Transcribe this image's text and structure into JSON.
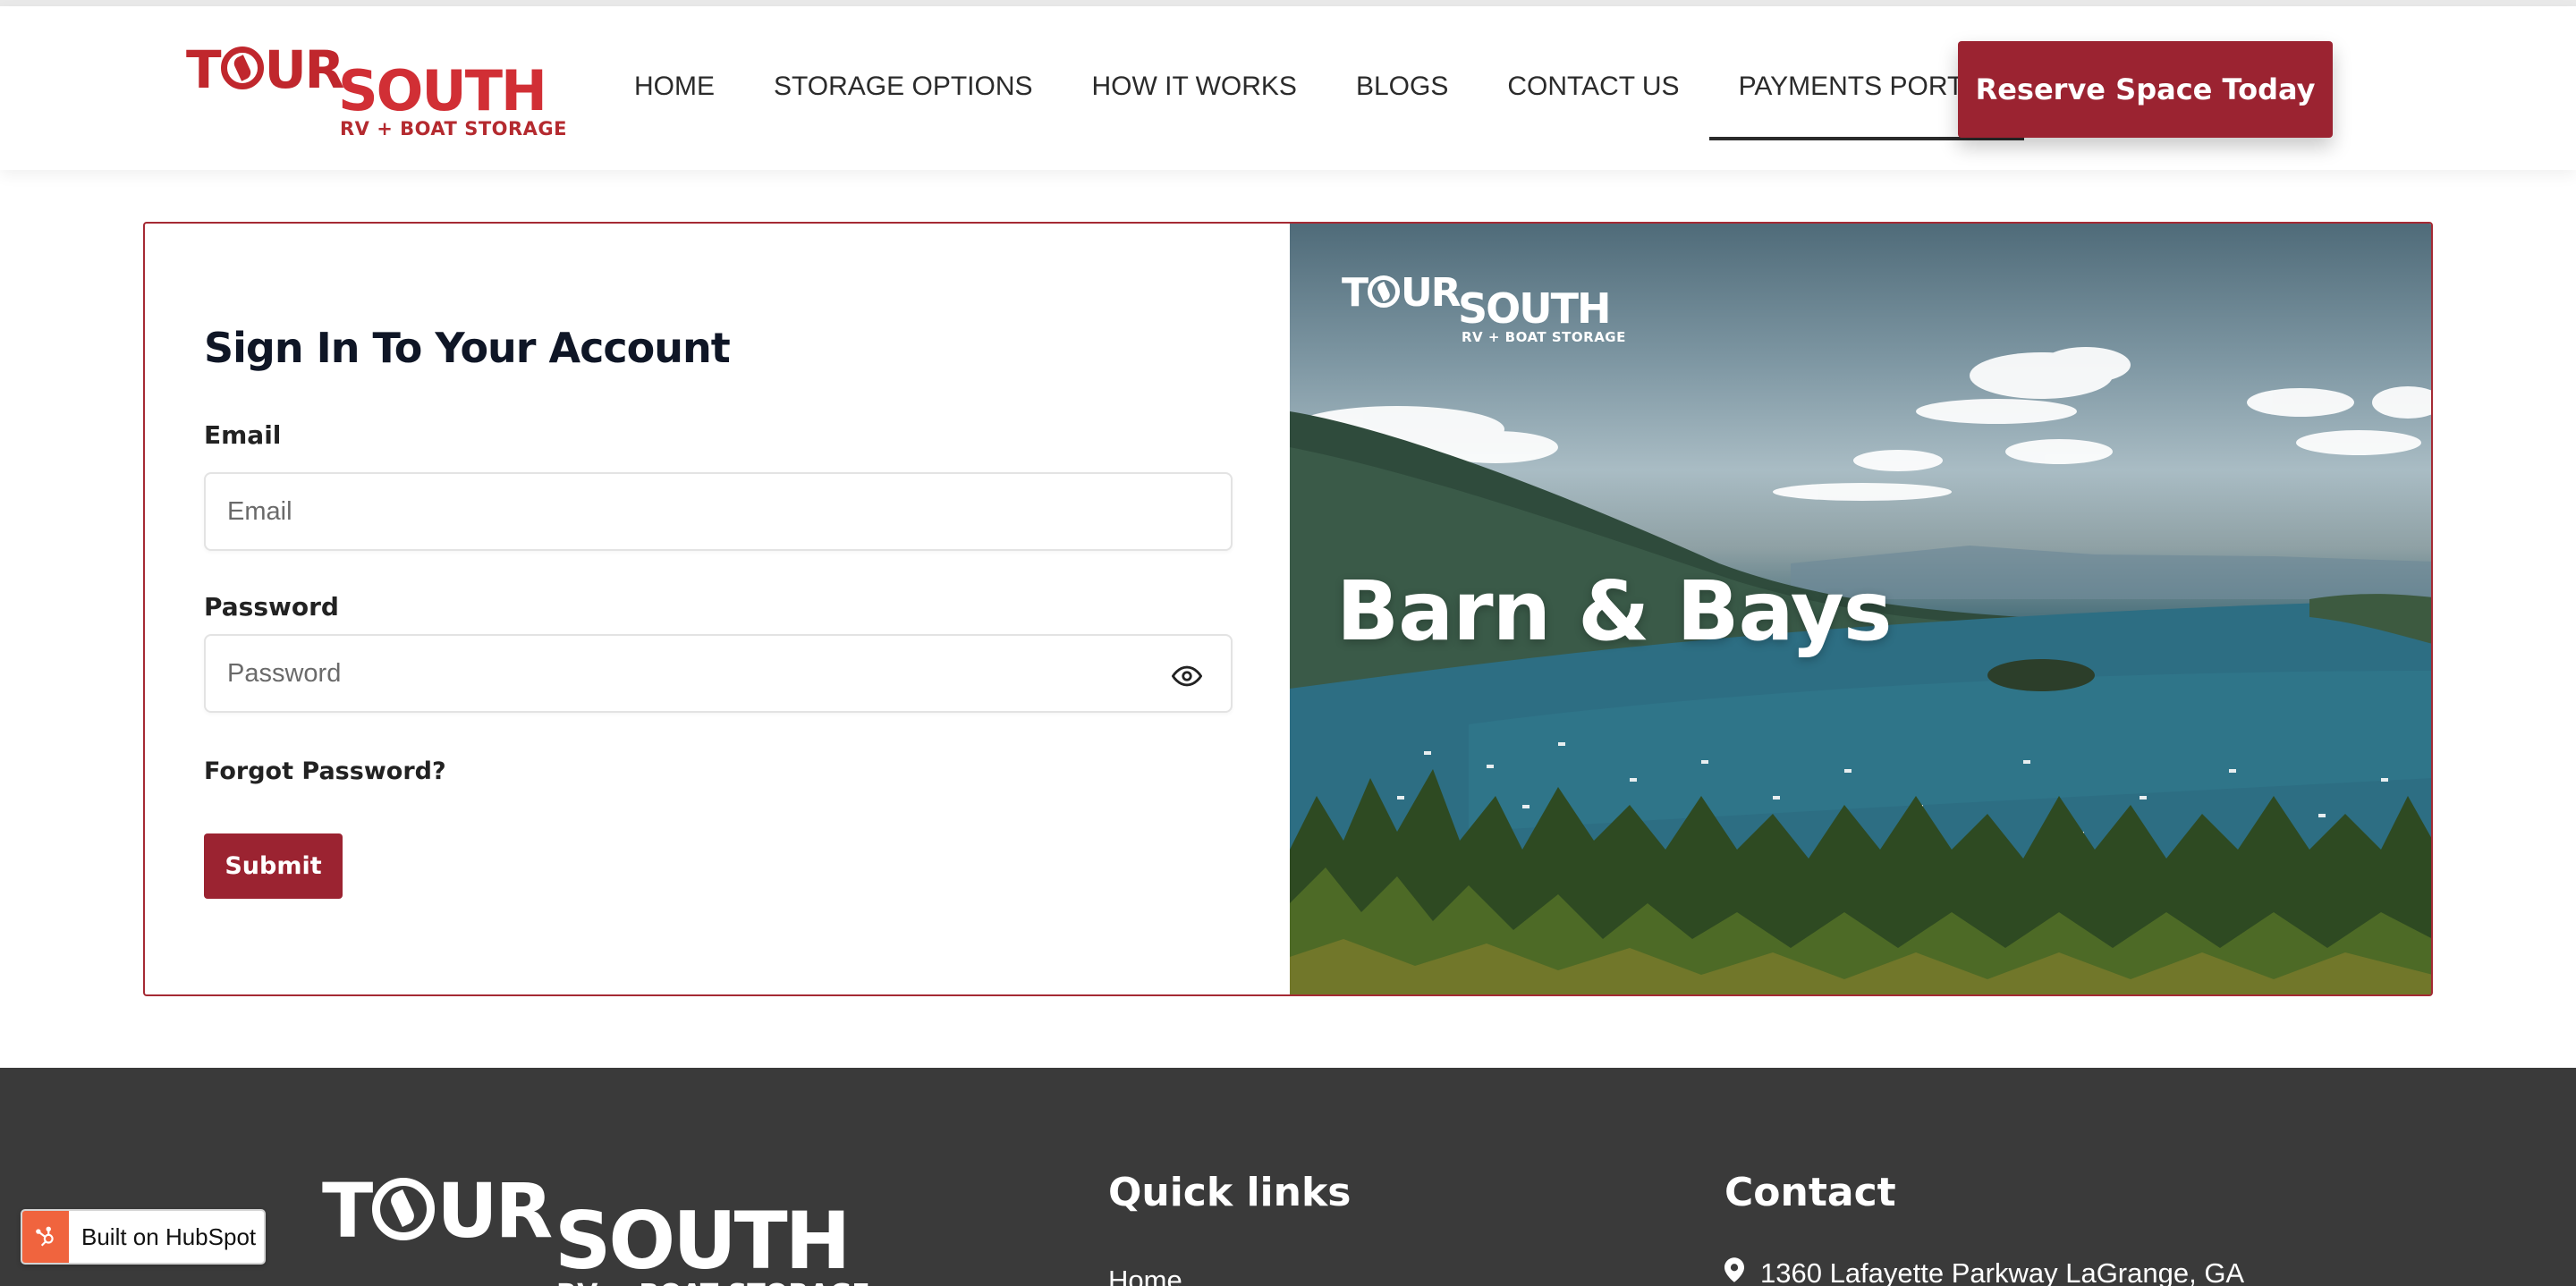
{
  "brand": {
    "logo_word1": "TOUR",
    "logo_word2": "SOUTH",
    "tagline": "RV + BOAT STORAGE",
    "primary_color": "#9b2331",
    "logo_red": "#c0272d"
  },
  "nav": {
    "items": [
      {
        "label": "HOME"
      },
      {
        "label": "STORAGE OPTIONS"
      },
      {
        "label": "HOW IT WORKS"
      },
      {
        "label": "BLOGS"
      },
      {
        "label": "CONTACT US"
      },
      {
        "label": "PAYMENTS PORTAL",
        "active": true
      }
    ],
    "cta_label": "Reserve Space Today"
  },
  "signin": {
    "title": "Sign In To Your Account",
    "email_label": "Email",
    "email_placeholder": "Email",
    "email_value": "",
    "password_label": "Password",
    "password_placeholder": "Password",
    "password_value": "",
    "show_password_icon": "eye-icon",
    "forgot_label": "Forgot Password?",
    "submit_label": "Submit"
  },
  "hero": {
    "title": "Barn & Bays"
  },
  "footer": {
    "quick_links_heading": "Quick links",
    "quick_links": [
      "Home"
    ],
    "contact_heading": "Contact",
    "address": "1360 Lafayette Parkway LaGrange, GA",
    "address_icon": "map-pin-icon",
    "background": "#3a3a3a"
  },
  "badge": {
    "label": "Built on HubSpot",
    "icon": "hubspot-icon",
    "color": "#f0643e"
  }
}
